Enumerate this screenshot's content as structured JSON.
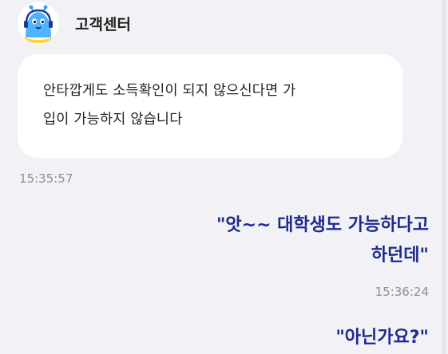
{
  "header": {
    "agent_name": "고객센터",
    "avatar_icon": "blue-mascot-avatar-icon"
  },
  "messages": [
    {
      "direction": "incoming",
      "lines": [
        "안타깝게도 소득확인이 되지 않으신다면 가",
        "입이 가능하지 않습니다"
      ],
      "time": "15:35:57"
    },
    {
      "direction": "outgoing",
      "lines": [
        "\"앗~~ 대학생도 가능하다고",
        "하던데\""
      ],
      "time": "15:36:24"
    },
    {
      "direction": "outgoing",
      "lines": [
        "\"아닌가요?\""
      ]
    }
  ],
  "colors": {
    "background": "#f2f2f6",
    "incoming_bubble": "#ffffff",
    "outgoing_text": "#1d2a8f",
    "timestamp": "#8e8e95"
  }
}
